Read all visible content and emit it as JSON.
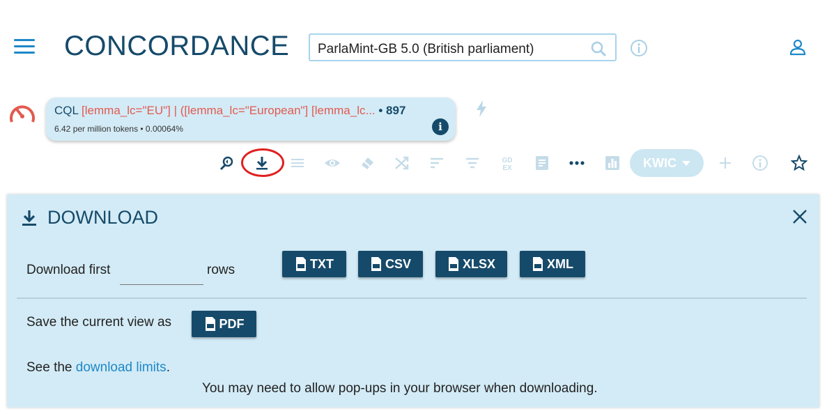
{
  "header": {
    "title": "CONCORDANCE",
    "corpus": "ParlaMint-GB 5.0 (British parliament)"
  },
  "query": {
    "type": "CQL",
    "text": " [lemma_lc=\"EU\"] | ([lemma_lc=\"European\"] [lemma_lc... ",
    "count": "• 897",
    "stats": "6.42 per million tokens • 0.00064%",
    "info_glyph": "i"
  },
  "toolbar": {
    "view_mode": "KWIC",
    "icons": [
      "search-icon",
      "download-icon",
      "lines-icon",
      "eye-icon",
      "eraser-icon",
      "shuffle-icon",
      "sort-icon",
      "filter-icon",
      "gdex-icon",
      "document-icon",
      "more-icon",
      "chart-icon",
      "plus-icon",
      "info-icon",
      "star-icon"
    ],
    "gdex_label": "GD\nEX"
  },
  "panel": {
    "title": "DOWNLOAD",
    "download_first": "Download first",
    "rows_value": "",
    "rows_label": "rows",
    "formats": [
      "TXT",
      "CSV",
      "XLSX",
      "XML"
    ],
    "save_view": "Save the current view as",
    "pdf_label": "PDF",
    "see_the": "See the ",
    "limits_link": "download limits",
    "period": ".",
    "popup_note": "You may need to allow pop-ups in your browser when downloading."
  },
  "colors": {
    "primary": "#164a6a",
    "accent": "#1e88c8",
    "panel_bg": "#d3ebf6",
    "query_red": "#e25a50",
    "highlight_ring": "#e02020"
  }
}
